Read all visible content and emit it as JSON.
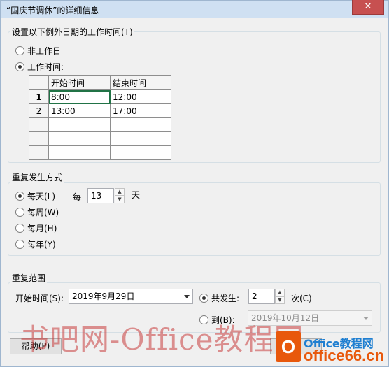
{
  "window": {
    "title": "“国庆节调休”的详细信息",
    "close_glyph": "✕"
  },
  "work_time_group": {
    "legend": "设置以下例外日期的工作时间(T)",
    "options": [
      {
        "label": "非工作日",
        "selected": false
      },
      {
        "label": "工作时间:",
        "selected": true
      }
    ],
    "table": {
      "headers": [
        "",
        "开始时间",
        "结束时间"
      ],
      "rows": [
        {
          "num": "1",
          "start": "8:00",
          "end": "12:00"
        },
        {
          "num": "2",
          "start": "13:00",
          "end": "17:00"
        },
        {
          "num": "",
          "start": "",
          "end": ""
        },
        {
          "num": "",
          "start": "",
          "end": ""
        },
        {
          "num": "",
          "start": "",
          "end": ""
        }
      ]
    }
  },
  "recurrence_pattern": {
    "legend": "重复发生方式",
    "options": [
      {
        "label": "每天(L)",
        "selected": true
      },
      {
        "label": "每周(W)",
        "selected": false
      },
      {
        "label": "每月(H)",
        "selected": false
      },
      {
        "label": "每年(Y)",
        "selected": false
      }
    ],
    "every_label": "每",
    "every_value": "13",
    "unit_label": "天"
  },
  "recurrence_range": {
    "legend": "重复范围",
    "start_label": "开始时间(S):",
    "start_value": "2019年9月29日",
    "occurrences_label": "共发生:",
    "occurrences_selected": true,
    "occurrences_value": "2",
    "occurrences_unit": "次(C)",
    "end_by_label": "到(B):",
    "end_by_selected": false,
    "end_by_value": "2019年10月12日"
  },
  "footer": {
    "help_button": "帮助(P)"
  },
  "watermark": {
    "text": "书吧网-Office教程网",
    "logo_letter": "O",
    "logo_top": "Office教程网",
    "logo_bottom": "office66.cn"
  }
}
